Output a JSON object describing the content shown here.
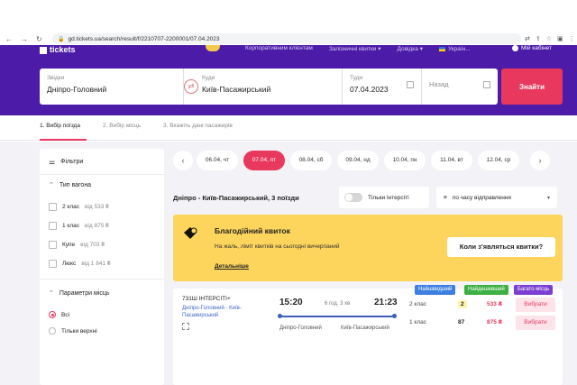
{
  "browser": {
    "url": "gd.tickets.ua/search/result/f/2210707-2200001/07.04.2023"
  },
  "header": {
    "logo": "tickets",
    "nav": [
      "Корпоративним клієнтам",
      "Залізничні квитки ▾",
      "Довідка ▾",
      "Україн..."
    ],
    "cabinet": "Мій кабінет"
  },
  "search": {
    "from_label": "Звідки",
    "from_value": "Дніпро-Головний",
    "to_label": "Куди",
    "to_value": "Київ-Пасажирський",
    "date_label": "Туди",
    "date_value": "07.04.2023",
    "return_label": "Назад",
    "find_button": "Знайти"
  },
  "steps": [
    "1. Вибір поїзда",
    "2. Вибір місць",
    "3. Вкажіть дані пасажирів"
  ],
  "sidebar": {
    "filters_label": "Фільтри",
    "wagon_type_label": "Тип вагона",
    "wagon_options": [
      {
        "name": "2 клас",
        "price": "від 533 ₴"
      },
      {
        "name": "1 клас",
        "price": "від 875 ₴"
      },
      {
        "name": "Купе",
        "price": "від 703 ₴"
      },
      {
        "name": "Люкс",
        "price": "від 1 841 ₴"
      }
    ],
    "seat_params_label": "Параметри місць",
    "seat_options": [
      "Всі",
      "Тільки верхні"
    ]
  },
  "dates": [
    "06.04, чт",
    "07.04, пт",
    "08.04, сб",
    "09.04, нд",
    "10.04, пн",
    "11.04, вт",
    "12.04, ср"
  ],
  "active_date_index": 1,
  "route_title": "Дніпро - Київ-Пасажирський, 3 поїзди",
  "toggle_label": "Тільки Інтерсіті",
  "sort_label": "по часу відправлення",
  "banner": {
    "title": "Благодійний квиток",
    "text": "На жаль, ліміт квитків на сьогодні вичерпаний",
    "link": "Детальніше",
    "button": "Коли з'являться квитки?"
  },
  "train": {
    "number": "731Ш ІНТЕРСІТІ+",
    "route": "Дніпро-Головний - Київ-Пасажирський",
    "depart_time": "15:20",
    "duration": "6 год. 3 хв",
    "arrive_time": "21:23",
    "depart_station": "Дніпро-Головний",
    "arrive_station": "Київ-Пасажирський",
    "badges": [
      "Найшвидший",
      "Найдешевший",
      "Багато місць"
    ],
    "badge_colors": [
      "#3d7fe0",
      "#3cb043",
      "#7a3fd0"
    ],
    "classes": [
      {
        "name": "2 клас",
        "seats": "2",
        "price": "533 ₴",
        "button": "Вибрати"
      },
      {
        "name": "1 клас",
        "seats": "87",
        "price": "875 ₴",
        "button": "Вибрати"
      }
    ]
  }
}
